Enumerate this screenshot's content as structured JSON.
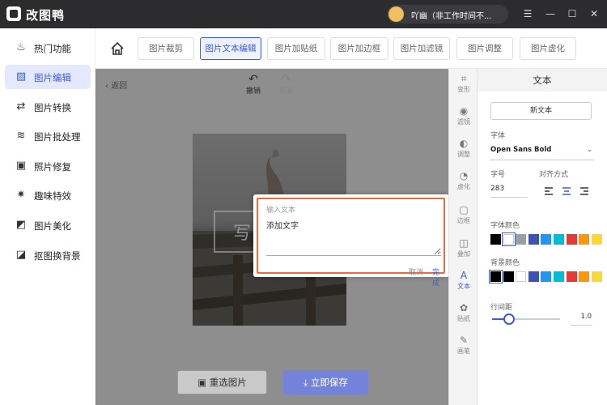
{
  "app": {
    "title": "改图鸭"
  },
  "user": {
    "name": "吖幽（非工作时间不..."
  },
  "window": {
    "menu_glyph": "☰",
    "minimize_glyph": "—",
    "maximize_glyph": "☐",
    "close_glyph": "✕"
  },
  "sidebar": {
    "items": [
      {
        "label": "热门功能",
        "icon": "fire-icon",
        "glyph": "♨"
      },
      {
        "label": "图片编辑",
        "icon": "image-edit-icon",
        "glyph": "▨"
      },
      {
        "label": "图片转换",
        "icon": "convert-icon",
        "glyph": "⇄"
      },
      {
        "label": "图片批处理",
        "icon": "batch-icon",
        "glyph": "≋"
      },
      {
        "label": "照片修复",
        "icon": "repair-icon",
        "glyph": "▣"
      },
      {
        "label": "趣味特效",
        "icon": "effects-icon",
        "glyph": "✷"
      },
      {
        "label": "图片美化",
        "icon": "beautify-icon",
        "glyph": "◩"
      },
      {
        "label": "抠图换背景",
        "icon": "cutout-icon",
        "glyph": "◪"
      }
    ]
  },
  "toolbar": {
    "tabs": [
      {
        "label": "图片裁剪"
      },
      {
        "label": "图片文本编辑"
      },
      {
        "label": "图片加贴纸"
      },
      {
        "label": "图片加边框"
      },
      {
        "label": "图片加滤镜"
      },
      {
        "label": "图片调整"
      },
      {
        "label": "图片虚化"
      }
    ]
  },
  "canvas": {
    "back_label": "返回",
    "undo_label": "撤销",
    "redo_label": "恢复",
    "reselect_label": "重选图片",
    "save_label": "立即保存"
  },
  "dialog": {
    "label": "输入文本",
    "value": "添加文字",
    "cancel_label": "取消",
    "done_label": "完成"
  },
  "tools": [
    {
      "label": "变形",
      "glyph": "⌗"
    },
    {
      "label": "滤镜",
      "glyph": "◉"
    },
    {
      "label": "调整",
      "glyph": "◐"
    },
    {
      "label": "虚化",
      "glyph": "◔"
    },
    {
      "label": "边框",
      "glyph": "▢"
    },
    {
      "label": "叠加",
      "glyph": "◫"
    },
    {
      "label": "文本",
      "glyph": "A"
    },
    {
      "label": "贴纸",
      "glyph": "✿"
    },
    {
      "label": "画笔",
      "glyph": "✎"
    }
  ],
  "panel": {
    "title": "文本",
    "new_text_label": "新文本",
    "font_label": "字体",
    "font_value": "Open Sans Bold",
    "size_label": "字号",
    "size_value": "283",
    "align_label": "对齐方式",
    "font_color_label": "字体颜色",
    "bg_color_label": "背景颜色",
    "line_spacing_label": "行间距",
    "line_spacing_value": "1.0",
    "line_spacing_slider": 0.25,
    "font_colors": [
      "#000000",
      "#ffffff",
      "#9e9e9e",
      "#3f51b5",
      "#2196f3",
      "#00bcd4",
      "#e53935",
      "#ff9800",
      "#fdd835"
    ],
    "bg_colors": [
      "#000000",
      "#000000",
      "#ffffff",
      "#3f51b5",
      "#2196f3",
      "#00bcd4",
      "#e53935",
      "#ff9800",
      "#fdd835"
    ]
  },
  "colors": {
    "accent": "#3b5bdb",
    "dialog_border": "#ef6b3b"
  }
}
